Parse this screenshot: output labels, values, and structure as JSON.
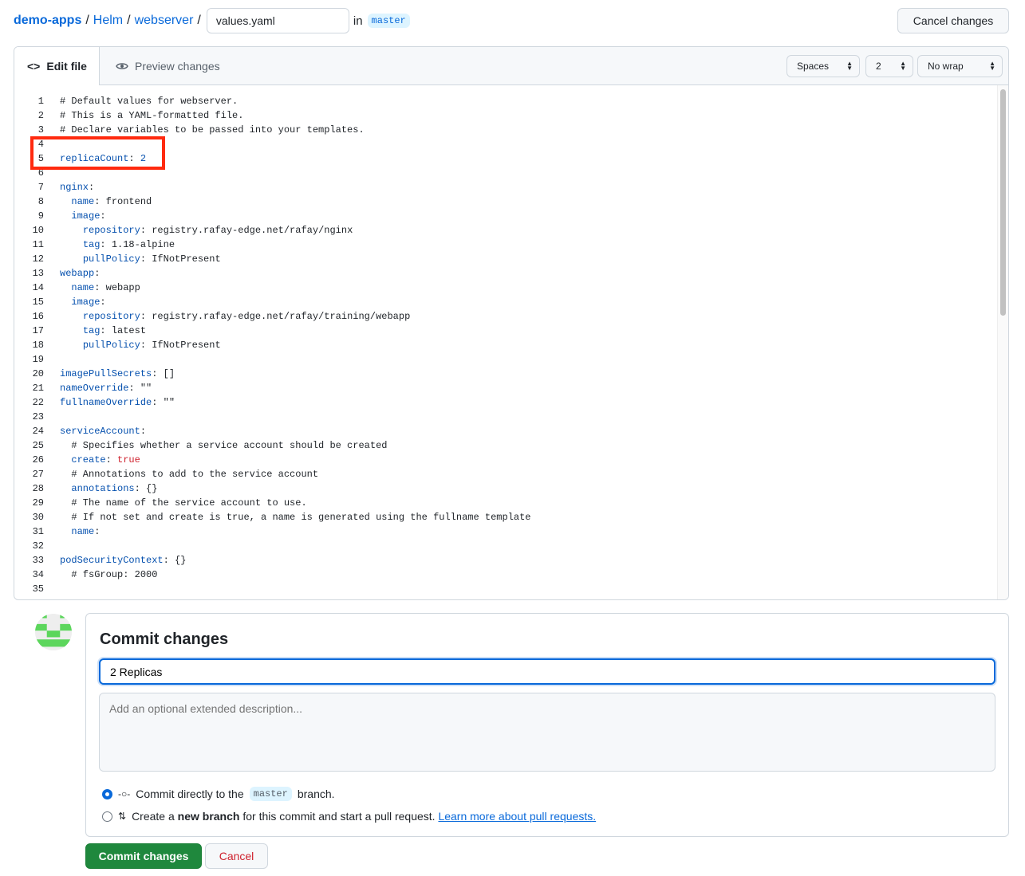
{
  "breadcrumb": {
    "items": [
      "demo-apps",
      "Helm",
      "webserver"
    ],
    "separator": "/",
    "filename": "values.yaml",
    "in_label": "in",
    "branch": "master"
  },
  "header": {
    "cancel_changes": "Cancel changes"
  },
  "editor": {
    "tabs": [
      {
        "label": "Edit file",
        "icon": "code-icon",
        "active": true
      },
      {
        "label": "Preview changes",
        "icon": "eye-icon",
        "active": false
      }
    ],
    "indent_mode": "Spaces",
    "indent_size": "2",
    "wrap_mode": "No wrap",
    "highlighted_lines": [
      4,
      5
    ],
    "lines": [
      [
        {
          "t": "p",
          "v": "# Default values for webserver."
        }
      ],
      [
        {
          "t": "p",
          "v": "# This is a YAML-formatted file."
        }
      ],
      [
        {
          "t": "p",
          "v": "# Declare variables to be passed into your templates."
        }
      ],
      [],
      [
        {
          "t": "k",
          "v": "replicaCount"
        },
        {
          "t": "p",
          "v": ": "
        },
        {
          "t": "num",
          "v": "2"
        }
      ],
      [],
      [
        {
          "t": "k",
          "v": "nginx"
        },
        {
          "t": "p",
          "v": ":"
        }
      ],
      [
        {
          "t": "p",
          "v": "  "
        },
        {
          "t": "k",
          "v": "name"
        },
        {
          "t": "p",
          "v": ": frontend"
        }
      ],
      [
        {
          "t": "p",
          "v": "  "
        },
        {
          "t": "k",
          "v": "image"
        },
        {
          "t": "p",
          "v": ":"
        }
      ],
      [
        {
          "t": "p",
          "v": "    "
        },
        {
          "t": "k",
          "v": "repository"
        },
        {
          "t": "p",
          "v": ": registry.rafay-edge.net/rafay/nginx"
        }
      ],
      [
        {
          "t": "p",
          "v": "    "
        },
        {
          "t": "k",
          "v": "tag"
        },
        {
          "t": "p",
          "v": ": 1.18-alpine"
        }
      ],
      [
        {
          "t": "p",
          "v": "    "
        },
        {
          "t": "k",
          "v": "pullPolicy"
        },
        {
          "t": "p",
          "v": ": IfNotPresent"
        }
      ],
      [
        {
          "t": "k",
          "v": "webapp"
        },
        {
          "t": "p",
          "v": ":"
        }
      ],
      [
        {
          "t": "p",
          "v": "  "
        },
        {
          "t": "k",
          "v": "name"
        },
        {
          "t": "p",
          "v": ": webapp"
        }
      ],
      [
        {
          "t": "p",
          "v": "  "
        },
        {
          "t": "k",
          "v": "image"
        },
        {
          "t": "p",
          "v": ":"
        }
      ],
      [
        {
          "t": "p",
          "v": "    "
        },
        {
          "t": "k",
          "v": "repository"
        },
        {
          "t": "p",
          "v": ": registry.rafay-edge.net/rafay/training/webapp"
        }
      ],
      [
        {
          "t": "p",
          "v": "    "
        },
        {
          "t": "k",
          "v": "tag"
        },
        {
          "t": "p",
          "v": ": latest"
        }
      ],
      [
        {
          "t": "p",
          "v": "    "
        },
        {
          "t": "k",
          "v": "pullPolicy"
        },
        {
          "t": "p",
          "v": ": IfNotPresent"
        }
      ],
      [],
      [
        {
          "t": "k",
          "v": "imagePullSecrets"
        },
        {
          "t": "p",
          "v": ": []"
        }
      ],
      [
        {
          "t": "k",
          "v": "nameOverride"
        },
        {
          "t": "p",
          "v": ": \"\""
        }
      ],
      [
        {
          "t": "k",
          "v": "fullnameOverride"
        },
        {
          "t": "p",
          "v": ": \"\""
        }
      ],
      [],
      [
        {
          "t": "k",
          "v": "serviceAccount"
        },
        {
          "t": "p",
          "v": ":"
        }
      ],
      [
        {
          "t": "p",
          "v": "  # Specifies whether a service account should be created"
        }
      ],
      [
        {
          "t": "p",
          "v": "  "
        },
        {
          "t": "k",
          "v": "create"
        },
        {
          "t": "p",
          "v": ": "
        },
        {
          "t": "t",
          "v": "true"
        }
      ],
      [
        {
          "t": "p",
          "v": "  # Annotations to add to the service account"
        }
      ],
      [
        {
          "t": "p",
          "v": "  "
        },
        {
          "t": "k",
          "v": "annotations"
        },
        {
          "t": "p",
          "v": ": {}"
        }
      ],
      [
        {
          "t": "p",
          "v": "  # The name of the service account to use."
        }
      ],
      [
        {
          "t": "p",
          "v": "  # If not set and create is true, a name is generated using the fullname template"
        }
      ],
      [
        {
          "t": "p",
          "v": "  "
        },
        {
          "t": "k",
          "v": "name"
        },
        {
          "t": "p",
          "v": ":"
        }
      ],
      [],
      [
        {
          "t": "k",
          "v": "podSecurityContext"
        },
        {
          "t": "p",
          "v": ": {}"
        }
      ],
      [
        {
          "t": "p",
          "v": "  # fsGroup: 2000"
        }
      ],
      []
    ]
  },
  "commit": {
    "title": "Commit changes",
    "message": "2 Replicas",
    "description_placeholder": "Add an optional extended description...",
    "option_direct": {
      "before": "Commit directly to the",
      "branch": "master",
      "after": "branch.",
      "selected": true
    },
    "option_new": {
      "before": "Create a",
      "bold": "new branch",
      "after": "for this commit and start a pull request.",
      "link": "Learn more about pull requests.",
      "selected": false
    },
    "submit": "Commit changes",
    "cancel": "Cancel"
  },
  "colors": {
    "link": "#0969da",
    "primary": "#1f883d",
    "danger": "#cf222e",
    "highlight_box": "#ff2a0f"
  }
}
